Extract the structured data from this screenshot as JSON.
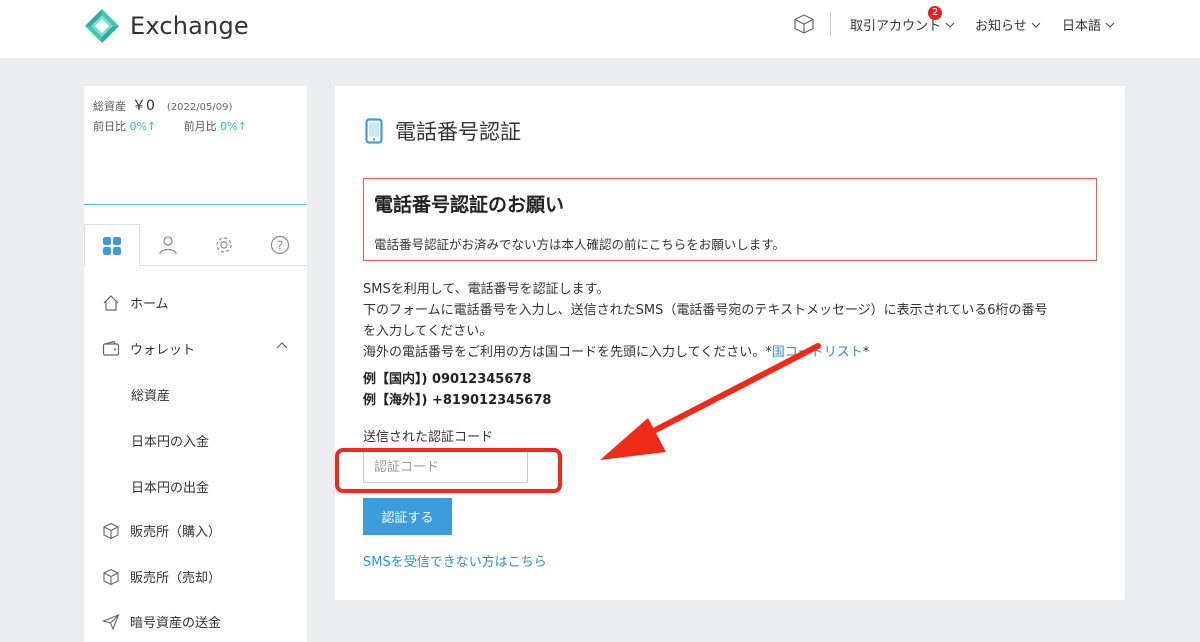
{
  "header": {
    "brand": "Exchange",
    "nav": [
      {
        "label": "取引アカウント",
        "badge": "2"
      },
      {
        "label": "お知らせ"
      },
      {
        "label": "日本語"
      }
    ]
  },
  "sidebar": {
    "summary": {
      "total_label": "総資産",
      "total_value": "￥0",
      "date": "(2022/05/09)",
      "day_label": "前日比",
      "day_value": "0%↑",
      "month_label": "前月比",
      "month_value": "0%↑"
    },
    "tabs": [
      "dashboard",
      "profile",
      "settings",
      "help"
    ],
    "menu": [
      {
        "label": "ホーム",
        "icon": "home-icon"
      },
      {
        "label": "ウォレット",
        "icon": "wallet-icon",
        "expanded": true
      },
      {
        "label": "総資産",
        "sub": true
      },
      {
        "label": "日本円の入金",
        "sub": true
      },
      {
        "label": "日本円の出金",
        "sub": true
      },
      {
        "label": "販売所（購入）",
        "icon": "cube-icon"
      },
      {
        "label": "販売所（売却）",
        "icon": "cube-icon"
      },
      {
        "label": "暗号資産の送金",
        "icon": "send-icon"
      }
    ]
  },
  "main": {
    "title": "電話番号認証",
    "alert": {
      "title": "電話番号認証のお願い",
      "body": "電話番号認証がお済みでない方は本人確認の前にこちらをお願いします。"
    },
    "description": [
      "SMSを利用して、電話番号を認証します。",
      "下のフォームに電話番号を入力し、送信されたSMS（電話番号宛のテキストメッセージ）に表示されている6桁の番号",
      "を入力してください。"
    ],
    "overseas": {
      "text": "海外の電話番号をご利用の方は国コードを先頭に入力してください。*",
      "link": "国コードリスト",
      "suffix": "*"
    },
    "examples": [
      "例【国内】) 09012345678",
      "例【海外】) +819012345678"
    ],
    "field_label": "送信された認証コード",
    "field_placeholder": "認証コード",
    "field_value": "",
    "submit_label": "認証する",
    "sms_link": "SMSを受信できない方はこちら"
  },
  "colors": {
    "accent": "#3d9ddb",
    "teal": "#2cc4b0",
    "alert_border": "#e55d4f",
    "annotation": "#f02a18",
    "badge": "#e0221e"
  }
}
